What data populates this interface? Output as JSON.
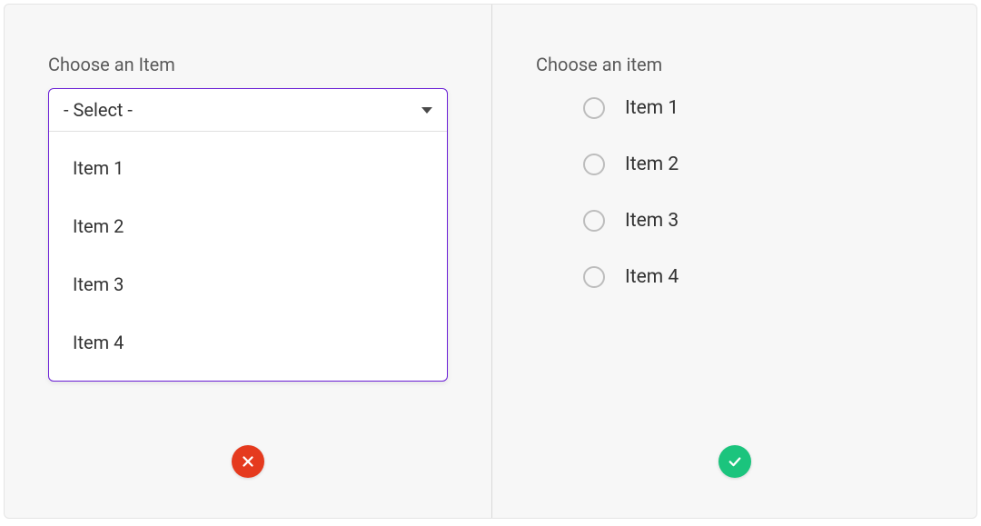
{
  "left": {
    "label": "Choose an Item",
    "placeholder": "- Select -",
    "options": [
      "Item 1",
      "Item 2",
      "Item 3",
      "Item 4"
    ]
  },
  "right": {
    "label": "Choose an item",
    "options": [
      "Item 1",
      "Item 2",
      "Item 3",
      "Item 4"
    ]
  },
  "colors": {
    "bad": "#e53a1e",
    "good": "#1bc47d",
    "select_border": "#6b1fd6"
  }
}
